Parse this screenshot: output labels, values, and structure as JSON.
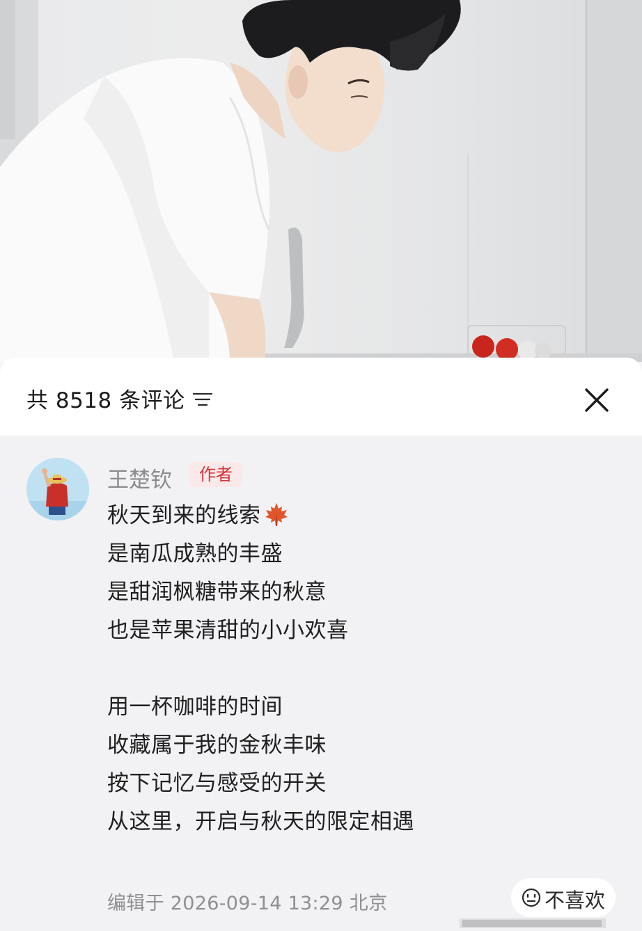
{
  "header": {
    "comment_count_label": "共 8518 条评论",
    "sort_icon": "sort-lines-icon",
    "close_icon": "close-x-icon"
  },
  "comment": {
    "username": "王楚钦",
    "badge": "作者",
    "lines": [
      "秋天到来的线索",
      "是南瓜成熟的丰盛",
      "是甜润枫糖带来的秋意",
      "也是苹果清甜的小小欢喜",
      "",
      "用一杯咖啡的时间",
      "收藏属于我的金秋丰味",
      "按下记忆与感受的开关",
      "从这里，开启与秋天的限定相遇"
    ],
    "first_line_emoji": "maple-leaf-icon",
    "meta": "编辑于 2026-09-14 13:29 北京",
    "dislike_label": "不喜欢",
    "dislike_icon": "neutral-face-icon"
  },
  "colors": {
    "badge_text": "#d4353b",
    "badge_bg": "#fbe9ea",
    "sheet_bg": "#f2f2f5",
    "muted_text": "#8b8b8e"
  }
}
